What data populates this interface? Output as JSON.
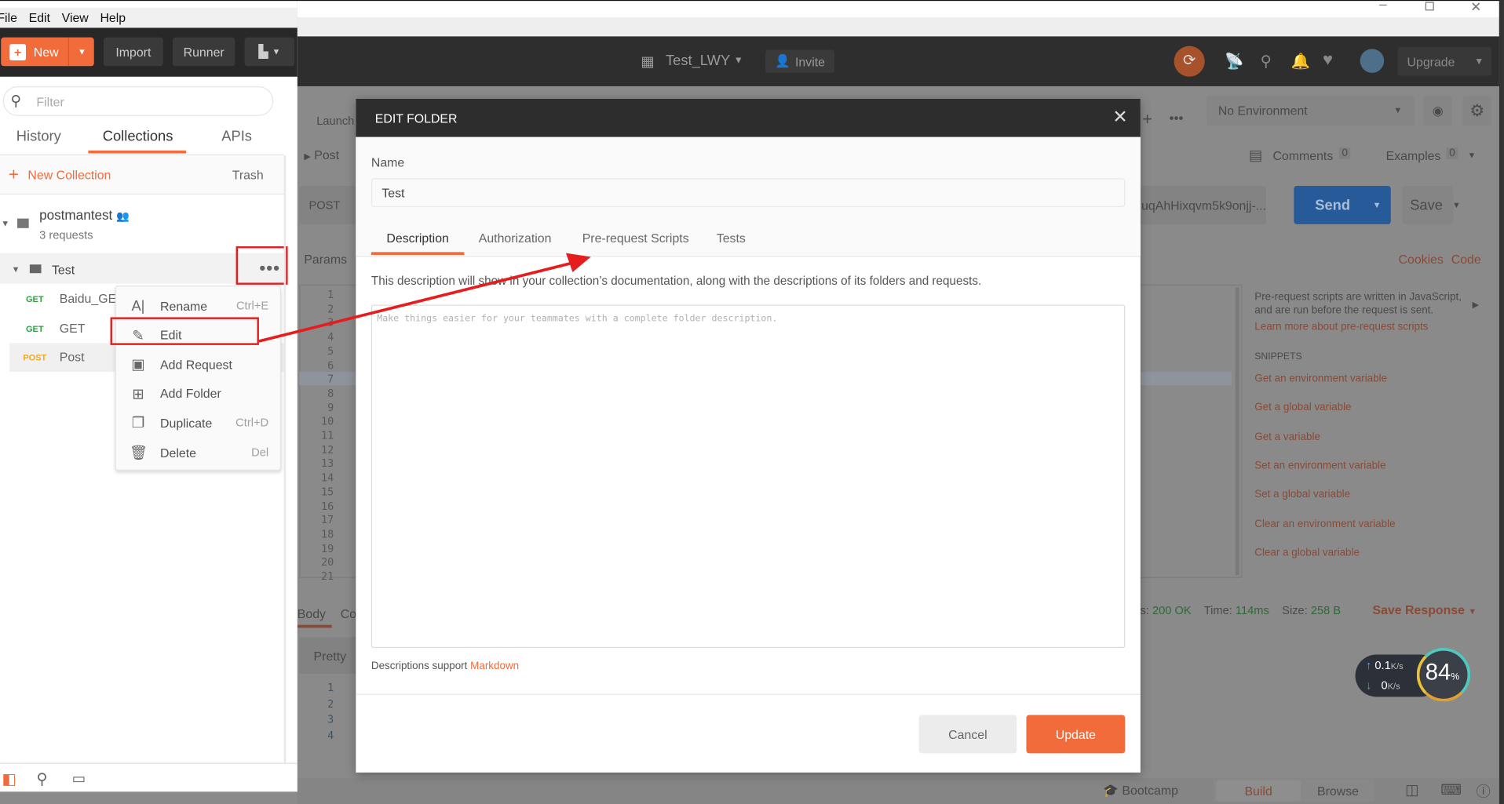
{
  "menubar": {
    "items": [
      "File",
      "Edit",
      "View",
      "Help"
    ]
  },
  "toolbar": {
    "new_label": "New",
    "import_label": "Import",
    "runner_label": "Runner",
    "workspace": "Test_LWY",
    "invite_label": "Invite",
    "upgrade_label": "Upgrade"
  },
  "sidebar": {
    "filter_placeholder": "Filter",
    "tabs": [
      {
        "label": "History"
      },
      {
        "label": "Collections",
        "active": true
      },
      {
        "label": "APIs"
      }
    ],
    "new_collection_label": "New Collection",
    "trash_label": "Trash",
    "collection": {
      "name": "postmantest",
      "count": "3 requests"
    },
    "folder": {
      "name": "Test"
    },
    "requests": [
      {
        "method": "GET",
        "name": "Baidu_GET"
      },
      {
        "method": "GET",
        "name": "GET"
      },
      {
        "method": "POST",
        "name": "Post"
      }
    ]
  },
  "context_menu": {
    "items": [
      {
        "label": "Rename",
        "shortcut": "Ctrl+E",
        "icon": "rename-icon"
      },
      {
        "label": "Edit",
        "shortcut": "",
        "icon": "pencil-icon"
      },
      {
        "label": "Add Request",
        "shortcut": "",
        "icon": "get-request-icon"
      },
      {
        "label": "Add Folder",
        "shortcut": "",
        "icon": "add-folder-icon"
      },
      {
        "label": "Duplicate",
        "shortcut": "Ctrl+D",
        "icon": "duplicate-icon"
      },
      {
        "label": "Delete",
        "shortcut": "Del",
        "icon": "trash-icon"
      }
    ]
  },
  "background": {
    "tab_label": "Launch",
    "request_name": "Post",
    "environment": "No Environment",
    "comments_label": "Comments",
    "comments_count": "0",
    "examples_label": "Examples",
    "examples_count": "0",
    "method": "POST",
    "url_tail": "uqAhHixqvm5k9onjj-...",
    "send_label": "Send",
    "save_label": "Save",
    "params_label": "Params",
    "cookies_label": "Cookies",
    "code_label": "Code",
    "editor_lines": [
      "1",
      "2",
      "3",
      "4",
      "5",
      "6",
      "7",
      "8",
      "9",
      "10",
      "11",
      "12",
      "13",
      "14",
      "15",
      "16",
      "17",
      "18",
      "19",
      "20",
      "21"
    ],
    "help_text1": "Pre-request scripts are written in JavaScript,",
    "help_text2": "and are run before the request is sent.",
    "learn_more": "Learn more about pre-request scripts",
    "snippets_title": "SNIPPETS",
    "snippets": [
      "Get an environment variable",
      "Get a global variable",
      "Get a variable",
      "Set an environment variable",
      "Set a global variable",
      "Clear an environment variable",
      "Clear a global variable"
    ],
    "body_tab": "Body",
    "cookies_tab_partial": "Co",
    "status_label": "us:",
    "status_value": "200 OK",
    "time_label": "Time:",
    "time_value": "114ms",
    "size_label": "Size:",
    "size_value": "258 B",
    "save_response_label": "Save Response",
    "pretty_label": "Pretty",
    "response_lines": [
      "1",
      "2",
      "3",
      "4"
    ],
    "bootcamp_label": "Bootcamp",
    "build_label": "Build",
    "browse_label": "Browse"
  },
  "net_widget": {
    "up": "0.1",
    "down": "0",
    "unit": "K/s",
    "percent": "84",
    "percent_sign": "%"
  },
  "modal": {
    "title": "EDIT FOLDER",
    "name_label": "Name",
    "name_value": "Test",
    "tabs": [
      {
        "label": "Description",
        "active": true
      },
      {
        "label": "Authorization"
      },
      {
        "label": "Pre-request Scripts"
      },
      {
        "label": "Tests"
      }
    ],
    "description_help": "This description will show in your collection’s documentation, along with the descriptions of its folders and requests.",
    "description_placeholder": "Make things easier for your teammates with a complete folder description.",
    "markdown_prefix": "Descriptions support",
    "markdown_link": "Markdown",
    "cancel_label": "Cancel",
    "update_label": "Update"
  },
  "colors": {
    "accent": "#f26b3a",
    "send_blue": "#2a6fbf",
    "annotation_red": "#e41e1e",
    "get_green": "#2f9e44",
    "post_yellow": "#f5a623"
  }
}
